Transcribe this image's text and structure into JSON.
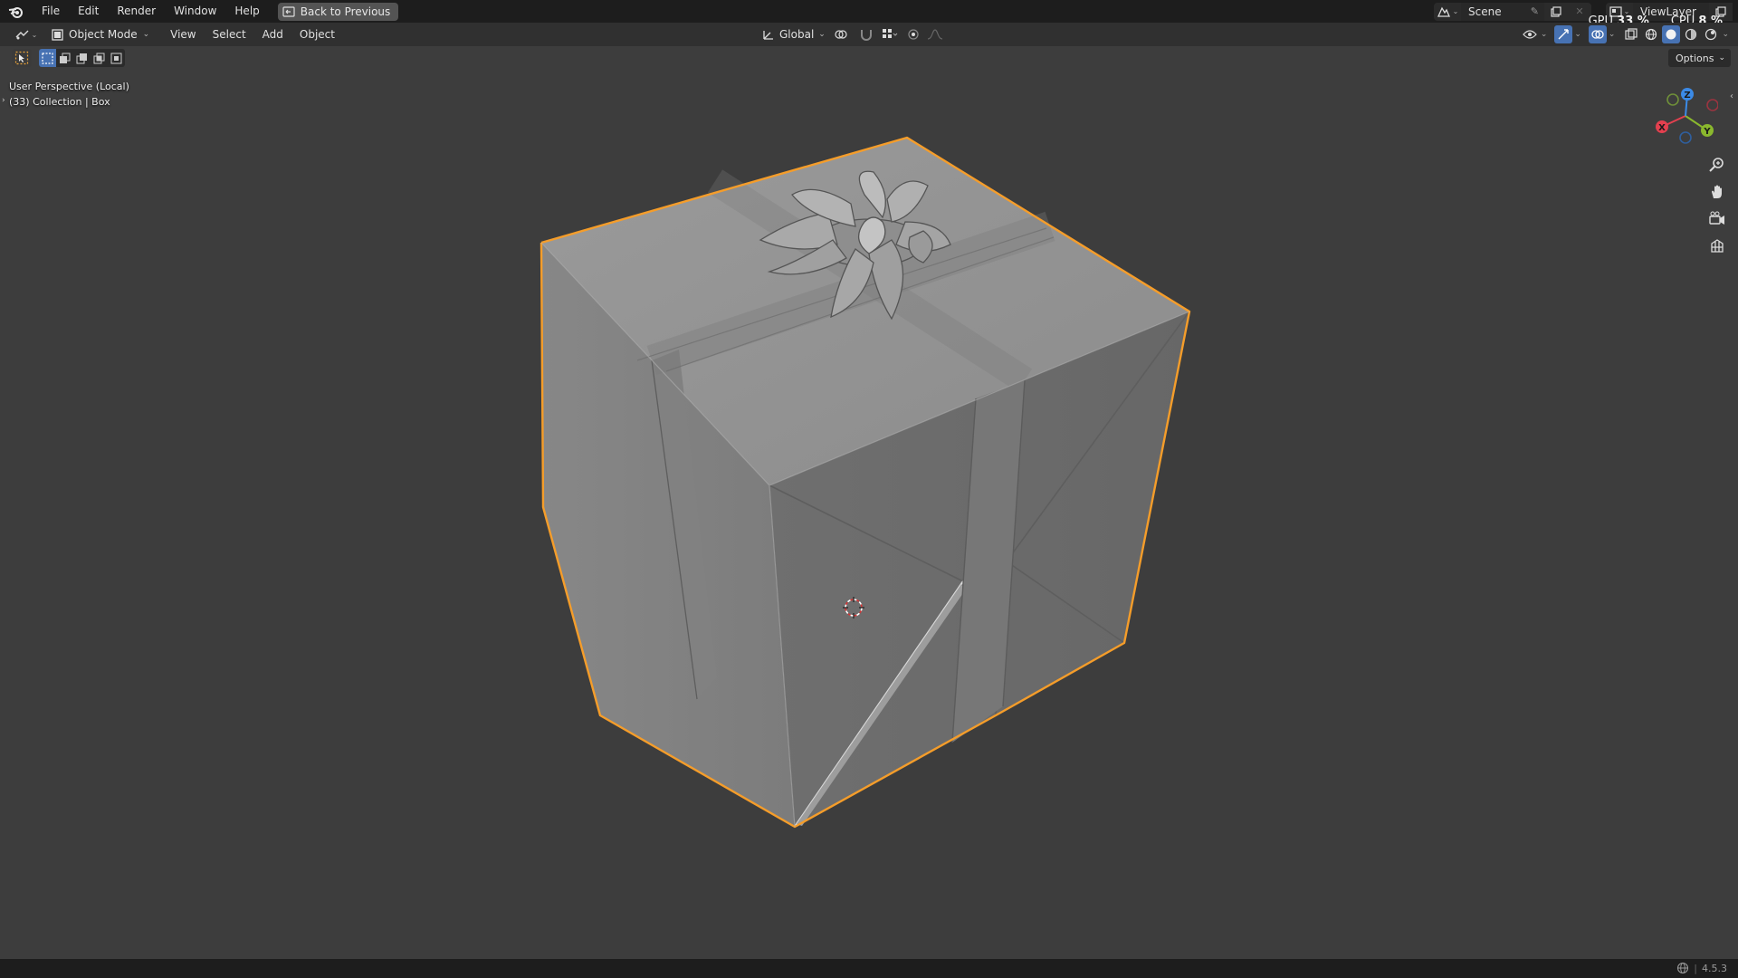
{
  "menu": {
    "items": [
      "File",
      "Edit",
      "Render",
      "Window",
      "Help"
    ],
    "back_button": "Back to Previous"
  },
  "scene": {
    "name": "Scene"
  },
  "view_layer": {
    "name": "ViewLayer"
  },
  "stats": {
    "gpu_label": "GPU",
    "gpu_value": "33 %",
    "cpu_label": "CPU",
    "cpu_value": "8 %"
  },
  "header": {
    "mode": "Object Mode",
    "menus": [
      "View",
      "Select",
      "Add",
      "Object"
    ],
    "transform_orientation": "Global"
  },
  "tool_header": {
    "options_label": "Options"
  },
  "viewport": {
    "view_name": "User Perspective (Local)",
    "collection_info": "(33) Collection | Box"
  },
  "gizmo": {
    "x_label": "X",
    "y_label": "Y",
    "z_label": "Z"
  },
  "status_bar": {
    "version": "4.5.3"
  },
  "colors": {
    "selection_outline": "#f59d2a",
    "axis_x": "#e3404f",
    "axis_y": "#8ab82e",
    "axis_z": "#3b8ae6",
    "active_button": "#4772b3"
  },
  "icons": [
    "blender-logo",
    "back-arrow-icon",
    "editor-type-icon",
    "object-mode-icon",
    "transform-orientation-icon",
    "pivot-icon",
    "snap-icon",
    "proportional-edit-icon",
    "visibility-icon",
    "gizmo-icon",
    "overlay-icon",
    "xray-icon",
    "shading-icons",
    "zoom-icon",
    "pan-hand-icon",
    "camera-icon",
    "ortho-grid-icon",
    "network-icon"
  ]
}
